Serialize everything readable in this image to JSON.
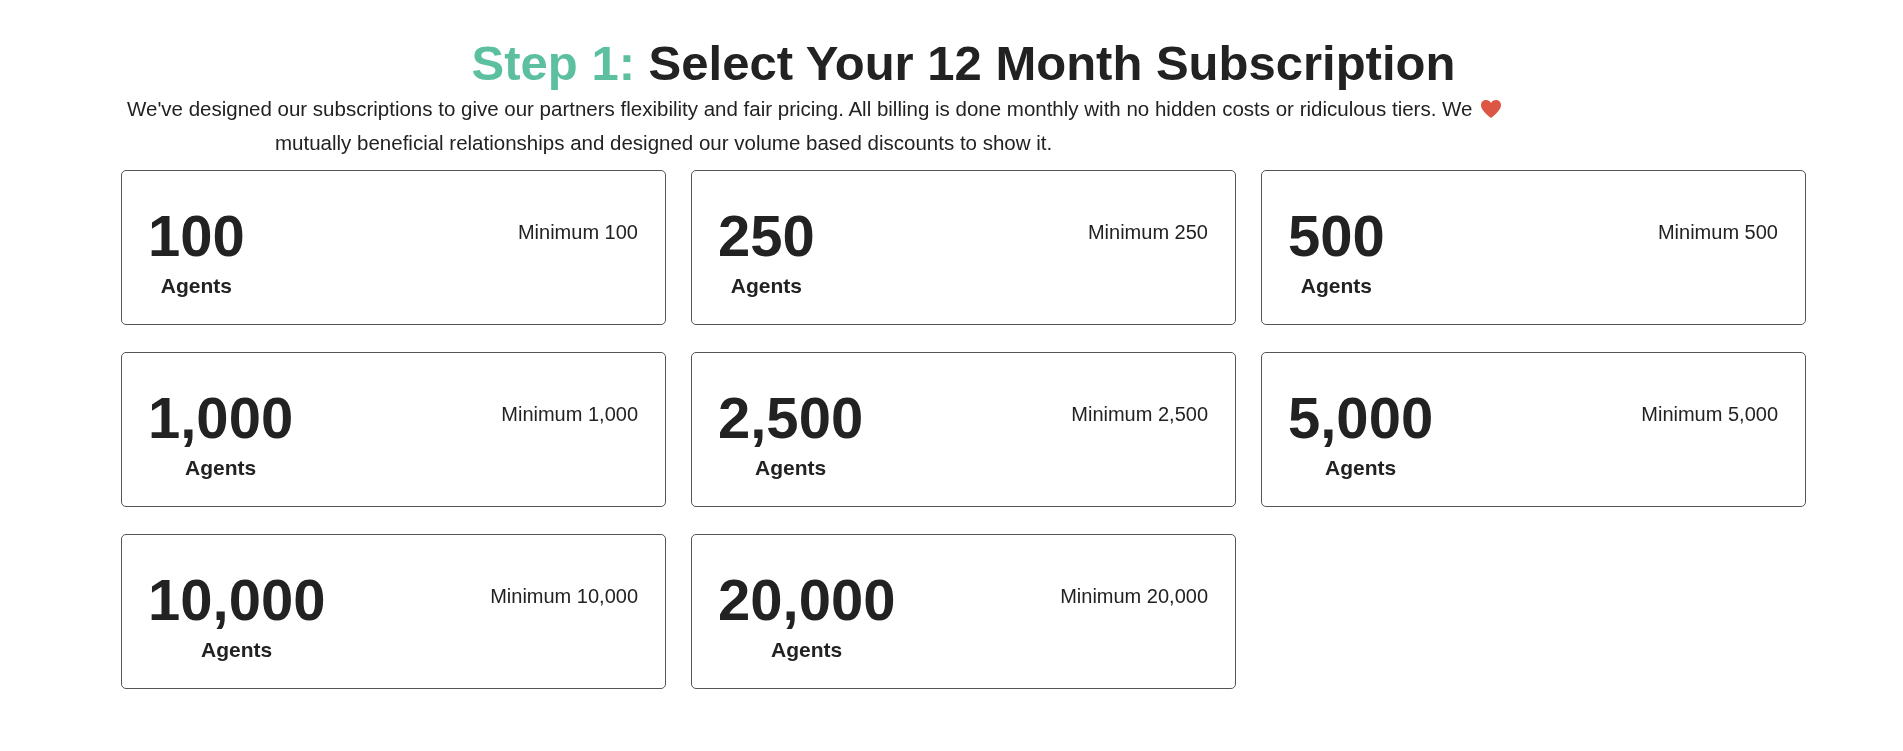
{
  "title": {
    "step": "Step 1:",
    "text": "Select Your 12 Month Subscription"
  },
  "description": {
    "line_1": "We've designed our subscriptions to give our partners flexibility and fair pricing. All billing is done monthly with no hidden costs or ridiculous tiers. We",
    "line_2": "mutually beneficial relationships and designed our volume based discounts to show it."
  },
  "plans": [
    {
      "count": "100",
      "unit": "Agents",
      "minimum": "Minimum 100"
    },
    {
      "count": "250",
      "unit": "Agents",
      "minimum": "Minimum 250"
    },
    {
      "count": "500",
      "unit": "Agents",
      "minimum": "Minimum 500"
    },
    {
      "count": "1,000",
      "unit": "Agents",
      "minimum": "Minimum 1,000"
    },
    {
      "count": "2,500",
      "unit": "Agents",
      "minimum": "Minimum 2,500"
    },
    {
      "count": "5,000",
      "unit": "Agents",
      "minimum": "Minimum 5,000"
    },
    {
      "count": "10,000",
      "unit": "Agents",
      "minimum": "Minimum 10,000"
    },
    {
      "count": "20,000",
      "unit": "Agents",
      "minimum": "Minimum 20,000"
    }
  ]
}
